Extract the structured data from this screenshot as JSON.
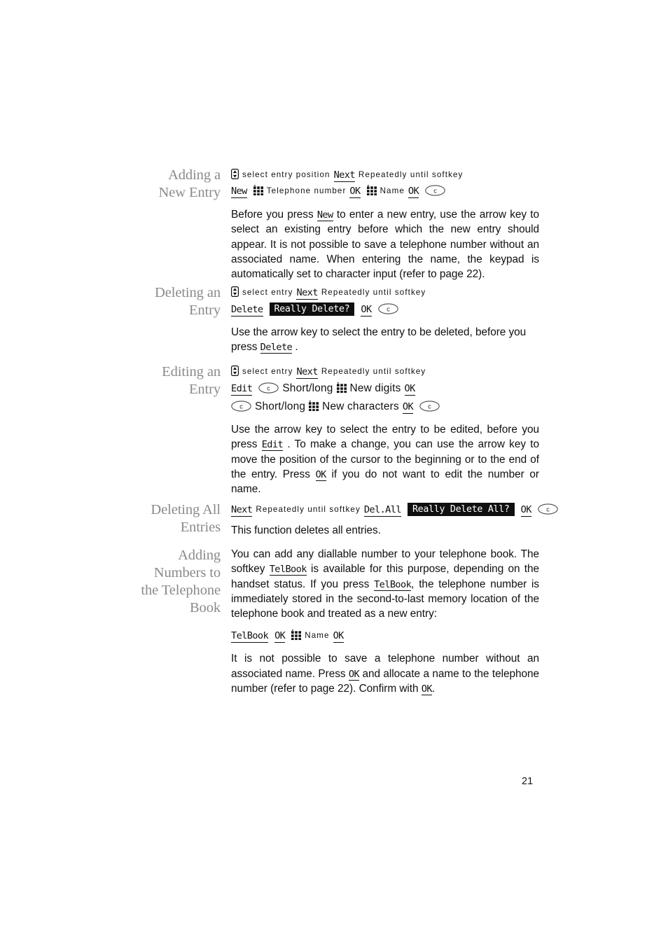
{
  "page": {
    "number": "21"
  },
  "sections": [
    {
      "id": "adding-new-entry",
      "heading_line1": "Adding a",
      "heading_line2": "New Entry",
      "seq1": {
        "icon_nav": "nav-updown-icon",
        "text1": "select entry position",
        "key1": "Next",
        "text2": "Repeatedly until softkey"
      },
      "seq2": {
        "key1": "New",
        "icon_pad": "keypad-icon",
        "text1": "Telephone number",
        "key2": "OK",
        "icon_pad2": "keypad-icon",
        "text2": "Name",
        "key3": "OK",
        "icon_c": "clear-key-icon"
      },
      "paragraph": "Before you press New to enter a new entry, use the arrow key to select an existing entry before which the new entry should appear. It is not possible to save a telephone number without an associated name. When entering the name, the keypad is automatically set to character input (refer to page 22).",
      "paragraph_parts": {
        "p1": "Before you press ",
        "k1": "New",
        "p2": " to enter a new entry, use the arrow key to select an existing entry before which the new entry should appear. It is not possible to save a telephone number without an associated name. When entering the name, the keypad is automatically set to character input (refer to page 22)."
      }
    },
    {
      "id": "deleting-entry",
      "heading_line1": "Deleting an",
      "heading_line2": "Entry",
      "seq1": {
        "icon_nav": "nav-updown-icon",
        "text1": "select entry",
        "key1": "Next",
        "text2": "Repeatedly until softkey"
      },
      "seq2": {
        "key1": "Delete",
        "prompt": "Really Delete?",
        "key2": "OK",
        "icon_c": "clear-key-icon"
      },
      "paragraph_parts": {
        "p1": "Use the arrow key to select the entry to be deleted, before you press ",
        "k1": "Delete",
        "p2": " ."
      }
    },
    {
      "id": "editing-entry",
      "heading_line1": "Editing an",
      "heading_line2": "Entry",
      "seq1": {
        "icon_nav": "nav-updown-icon",
        "text1": "select entry",
        "key1": "Next",
        "text2": "Repeatedly until softkey"
      },
      "seq2": {
        "key1": "Edit",
        "icon_c": "clear-key-icon",
        "text1": "Short/long",
        "icon_pad": "keypad-icon",
        "text2": "New digits",
        "key2": "OK"
      },
      "seq3": {
        "icon_c": "clear-key-icon",
        "text1": "Short/long",
        "icon_pad": "keypad-icon",
        "text2": "New characters",
        "key1": "OK",
        "icon_c2": "clear-key-icon"
      },
      "paragraph_parts": {
        "p1": "Use the arrow key to select the entry to be edited, before you press ",
        "k1": "Edit",
        "p2": " . To make a change, you can use the arrow key to move the position of the cursor to the beginning or to the end of the entry. Press ",
        "k2": "OK",
        "p3": " if you do not want to edit the number or name."
      }
    },
    {
      "id": "deleting-all-entries",
      "heading_line1": "Deleting All",
      "heading_line2": "Entries",
      "seq1": {
        "key1": "Next",
        "text1": "Repeatedly until softkey",
        "key2": "Del.All",
        "prompt": "Really Delete All?",
        "key3": "OK",
        "icon_c": "clear-key-icon"
      },
      "paragraph": "This function deletes all entries."
    },
    {
      "id": "adding-numbers-to-telephone-book",
      "heading_line1": "Adding",
      "heading_line2": "Numbers to",
      "heading_line3": "the Telephone",
      "heading_line4": "Book",
      "paragraph1_parts": {
        "p1": "You can add any diallable number to your telephone book. The softkey ",
        "k1": "TelBook",
        "p2": " is available for this purpose, depending on the handset status. If you press ",
        "k2": "TelBook",
        "p3": ", the telephone number is immediately stored in the second-to-last memory location of the telephone book and treated as a new entry:"
      },
      "seq1": {
        "key1": "TelBook",
        "key2": "OK",
        "icon_pad": "keypad-icon",
        "text1": "Name",
        "key3": "OK"
      },
      "paragraph2_parts": {
        "p1": "It is not possible to save a telephone number without an associated name. Press ",
        "k1": "OK",
        "p2": " and allocate a name to the telephone number (refer to page 22). Confirm with ",
        "k2": "OK",
        "p3": "."
      }
    }
  ],
  "colors": {
    "heading_gray": "#8a8a8a",
    "text_black": "#101010",
    "inverted_bg": "#101010",
    "inverted_fg": "#ffffff"
  }
}
